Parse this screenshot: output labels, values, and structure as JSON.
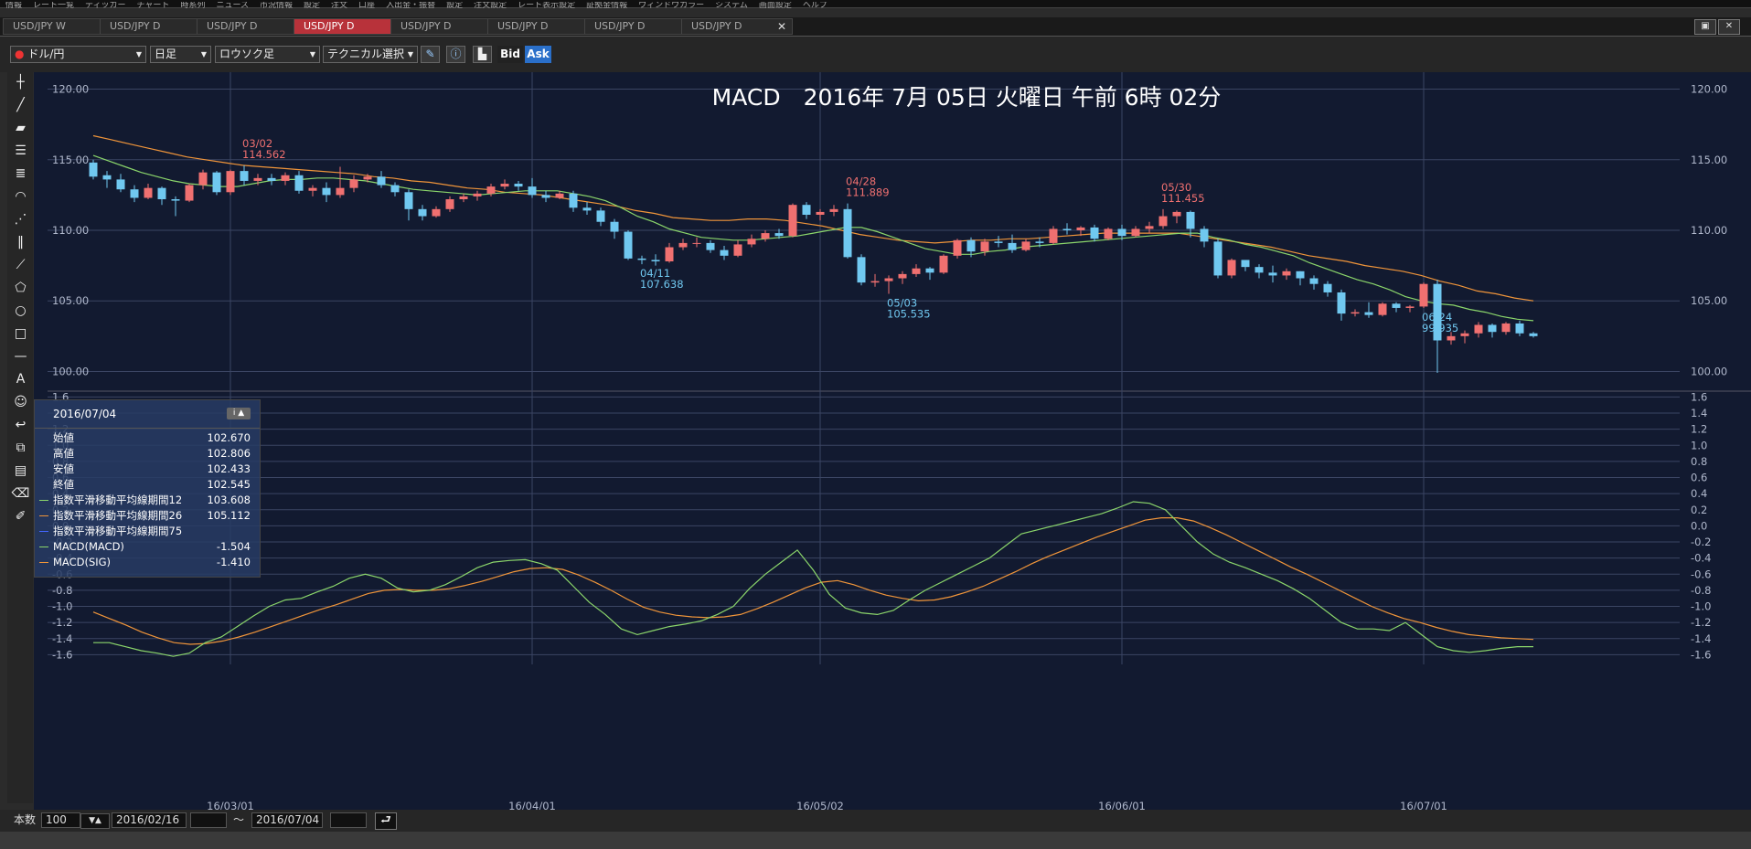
{
  "menu": [
    "情報",
    "レート一覧",
    "ティッカー",
    "チャート",
    "時系列",
    "ニュース",
    "市況情報",
    "設定",
    "注文",
    "口座",
    "入出金・振替",
    "設定",
    "注文設定",
    "レート表示設定",
    "証拠金情報",
    "ウィンドウカラー",
    "システム",
    "画面設定",
    "ヘルプ"
  ],
  "tabs": [
    {
      "label": "USD/JPY W",
      "active": false
    },
    {
      "label": "USD/JPY D",
      "active": false
    },
    {
      "label": "USD/JPY D",
      "active": false
    },
    {
      "label": "USD/JPY D",
      "active": true
    },
    {
      "label": "USD/JPY D",
      "active": false
    },
    {
      "label": "USD/JPY D",
      "active": false
    },
    {
      "label": "USD/JPY D",
      "active": false
    },
    {
      "label": "USD/JPY D",
      "active": false
    }
  ],
  "toolbar": {
    "pair": "ドル/円",
    "period": "日足",
    "chart_style": "ロウソク足",
    "technical": "テクニカル選択",
    "bid": "Bid",
    "ask": "Ask"
  },
  "colors": {
    "up": "#f07070",
    "down": "#70c8f0",
    "ema12": "#8bd66b",
    "ema26": "#f0953a",
    "macd": "#8bd66b",
    "sig": "#f0953a",
    "bg": "#121a30",
    "grid": "#3b4563"
  },
  "chart_data": {
    "type": "candlestick",
    "title": "MACD　2016年 7月 05日 火曜日 午前 6時 02分",
    "price_axis": {
      "ticks": [
        "120.00",
        "115.00",
        "110.00",
        "105.00",
        "100.00"
      ],
      "ylim": [
        98.8,
        121.2
      ]
    },
    "macd_axis": {
      "ticks": [
        "1.6",
        "1.4",
        "1.2",
        "1.0",
        "0.8",
        "0.6",
        "0.4",
        "0.2",
        "0.0",
        "-0.2",
        "-0.4",
        "-0.6",
        "-0.8",
        "-1.0",
        "-1.2",
        "-1.4",
        "-1.6"
      ],
      "ylim": [
        -1.72,
        1.65
      ]
    },
    "x_labels": [
      "16/03/01",
      "16/04/01",
      "16/05/02",
      "16/06/01",
      "16/07/01"
    ],
    "annotations": [
      {
        "date": "03/02",
        "value": "114.562",
        "color": "#f07070"
      },
      {
        "date": "04/11",
        "value": "107.638",
        "color": "#70c8f0"
      },
      {
        "date": "04/28",
        "value": "111.889",
        "color": "#f07070"
      },
      {
        "date": "05/03",
        "value": "105.535",
        "color": "#70c8f0"
      },
      {
        "date": "05/30",
        "value": "111.455",
        "color": "#f07070"
      },
      {
        "date": "06/24",
        "value": "99.935",
        "color": "#70c8f0"
      }
    ],
    "candles": [
      [
        114.8,
        113.8,
        115.0,
        113.6
      ],
      [
        113.9,
        113.6,
        114.2,
        113.0
      ],
      [
        113.6,
        112.9,
        114.0,
        112.7
      ],
      [
        112.9,
        112.3,
        113.2,
        112.0
      ],
      [
        112.3,
        113.0,
        113.3,
        112.2
      ],
      [
        113.0,
        112.2,
        113.1,
        111.8
      ],
      [
        112.2,
        112.1,
        112.4,
        111.0
      ],
      [
        112.1,
        113.2,
        113.3,
        112.0
      ],
      [
        113.2,
        114.1,
        114.3,
        112.9
      ],
      [
        114.1,
        112.7,
        114.2,
        112.5
      ],
      [
        112.7,
        114.2,
        114.3,
        112.5
      ],
      [
        114.2,
        113.5,
        114.6,
        113.2
      ],
      [
        113.5,
        113.7,
        114.0,
        113.2
      ],
      [
        113.7,
        113.5,
        114.0,
        113.2
      ],
      [
        113.5,
        113.9,
        114.1,
        113.2
      ],
      [
        113.9,
        112.8,
        114.2,
        112.6
      ],
      [
        112.8,
        113.0,
        113.2,
        112.4
      ],
      [
        113.0,
        112.5,
        113.4,
        112.0
      ],
      [
        112.5,
        113.0,
        114.5,
        112.3
      ],
      [
        113.0,
        113.6,
        113.9,
        112.7
      ],
      [
        113.6,
        113.8,
        114.0,
        113.4
      ],
      [
        113.8,
        113.2,
        114.2,
        113.0
      ],
      [
        113.2,
        112.7,
        113.4,
        112.4
      ],
      [
        112.7,
        111.5,
        112.9,
        110.7
      ],
      [
        111.5,
        111.0,
        111.8,
        110.7
      ],
      [
        111.0,
        111.5,
        111.7,
        110.9
      ],
      [
        111.5,
        112.2,
        112.4,
        111.3
      ],
      [
        112.2,
        112.4,
        112.6,
        112.0
      ],
      [
        112.4,
        112.6,
        112.8,
        112.1
      ],
      [
        112.6,
        113.1,
        113.3,
        112.4
      ],
      [
        113.1,
        113.3,
        113.6,
        112.9
      ],
      [
        113.3,
        113.1,
        113.5,
        112.8
      ],
      [
        113.1,
        112.5,
        113.7,
        112.3
      ],
      [
        112.5,
        112.3,
        112.8,
        112.0
      ],
      [
        112.3,
        112.6,
        112.8,
        112.2
      ],
      [
        112.6,
        111.6,
        112.8,
        111.3
      ],
      [
        111.6,
        111.4,
        112.0,
        111.1
      ],
      [
        111.4,
        110.6,
        111.6,
        110.3
      ],
      [
        110.6,
        109.9,
        110.8,
        109.4
      ],
      [
        109.9,
        108.0,
        110.0,
        107.9
      ],
      [
        108.0,
        107.9,
        108.2,
        107.6
      ],
      [
        107.9,
        107.8,
        108.3,
        107.5
      ],
      [
        107.8,
        108.8,
        109.1,
        107.7
      ],
      [
        108.8,
        109.1,
        109.4,
        108.6
      ],
      [
        109.1,
        109.1,
        109.5,
        108.8
      ],
      [
        109.1,
        108.6,
        109.3,
        108.4
      ],
      [
        108.6,
        108.2,
        108.9,
        107.9
      ],
      [
        108.2,
        109.0,
        109.3,
        108.1
      ],
      [
        109.0,
        109.4,
        109.7,
        108.8
      ],
      [
        109.4,
        109.8,
        110.0,
        109.2
      ],
      [
        109.8,
        109.6,
        110.1,
        109.4
      ],
      [
        109.6,
        111.8,
        111.9,
        109.5
      ],
      [
        111.8,
        111.1,
        112.0,
        110.8
      ],
      [
        111.1,
        111.3,
        111.5,
        110.7
      ],
      [
        111.3,
        111.5,
        111.8,
        111.0
      ],
      [
        111.5,
        108.1,
        111.9,
        108.0
      ],
      [
        108.1,
        106.3,
        108.3,
        106.1
      ],
      [
        106.3,
        106.4,
        106.9,
        106.0
      ],
      [
        106.4,
        106.6,
        106.8,
        105.5
      ],
      [
        106.6,
        106.9,
        107.1,
        106.2
      ],
      [
        106.9,
        107.3,
        107.6,
        106.7
      ],
      [
        107.3,
        107.0,
        107.4,
        106.5
      ],
      [
        107.0,
        108.2,
        108.3,
        106.9
      ],
      [
        108.2,
        109.3,
        109.4,
        108.0
      ],
      [
        109.3,
        108.5,
        109.5,
        108.1
      ],
      [
        108.5,
        109.2,
        109.4,
        108.2
      ],
      [
        109.2,
        109.1,
        109.6,
        108.8
      ],
      [
        109.1,
        108.6,
        109.7,
        108.4
      ],
      [
        108.6,
        109.2,
        109.4,
        108.5
      ],
      [
        109.2,
        109.1,
        109.5,
        108.8
      ],
      [
        109.1,
        110.1,
        110.3,
        109.0
      ],
      [
        110.1,
        110.0,
        110.5,
        109.7
      ],
      [
        110.0,
        110.2,
        110.3,
        109.6
      ],
      [
        110.2,
        109.4,
        110.4,
        109.2
      ],
      [
        109.4,
        110.1,
        110.2,
        109.3
      ],
      [
        110.1,
        109.6,
        110.4,
        109.3
      ],
      [
        109.6,
        110.1,
        110.3,
        109.5
      ],
      [
        110.1,
        110.3,
        110.6,
        109.8
      ],
      [
        110.3,
        111.0,
        111.5,
        110.1
      ],
      [
        111.0,
        111.3,
        111.4,
        110.5
      ],
      [
        111.3,
        110.1,
        111.4,
        109.5
      ],
      [
        110.1,
        109.2,
        110.3,
        108.8
      ],
      [
        109.2,
        106.8,
        109.4,
        106.6
      ],
      [
        106.8,
        107.9,
        108.0,
        106.6
      ],
      [
        107.9,
        107.4,
        107.9,
        107.1
      ],
      [
        107.4,
        107.0,
        107.6,
        106.6
      ],
      [
        107.0,
        106.8,
        107.5,
        106.3
      ],
      [
        106.8,
        107.1,
        107.3,
        106.5
      ],
      [
        107.1,
        106.6,
        107.1,
        106.1
      ],
      [
        106.6,
        106.2,
        106.8,
        105.8
      ],
      [
        106.2,
        105.6,
        106.4,
        105.3
      ],
      [
        105.6,
        104.1,
        105.8,
        103.6
      ],
      [
        104.1,
        104.2,
        104.4,
        103.9
      ],
      [
        104.2,
        104.0,
        104.9,
        103.8
      ],
      [
        104.0,
        104.8,
        104.9,
        103.9
      ],
      [
        104.8,
        104.5,
        104.9,
        104.2
      ],
      [
        104.5,
        104.6,
        104.7,
        104.2
      ],
      [
        104.6,
        106.2,
        106.3,
        104.5
      ],
      [
        106.2,
        102.2,
        106.5,
        99.9
      ],
      [
        102.2,
        102.5,
        102.8,
        101.9
      ],
      [
        102.5,
        102.7,
        102.9,
        102.0
      ],
      [
        102.7,
        103.3,
        103.5,
        102.4
      ],
      [
        103.3,
        102.8,
        103.4,
        102.4
      ],
      [
        102.8,
        103.4,
        103.5,
        102.6
      ],
      [
        103.4,
        102.7,
        103.6,
        102.5
      ],
      [
        102.7,
        102.5,
        102.8,
        102.4
      ]
    ],
    "first_x": 102,
    "last_x": 1677,
    "xlabel_idx": [
      10,
      32,
      53,
      75,
      97
    ],
    "ema12": [
      115.3,
      114.9,
      114.5,
      114.1,
      113.8,
      113.5,
      113.3,
      113.2,
      113.1,
      113.1,
      113.3,
      113.5,
      113.6,
      113.6,
      113.7,
      113.7,
      113.6,
      113.5,
      113.3,
      113.1,
      112.9,
      112.8,
      112.7,
      112.6,
      112.5,
      112.6,
      112.7,
      112.8,
      112.8,
      112.8,
      112.6,
      112.4,
      112.1,
      111.6,
      111.0,
      110.6,
      110.1,
      109.8,
      109.5,
      109.4,
      109.3,
      109.3,
      109.4,
      109.5,
      109.6,
      109.8,
      110.0,
      110.2,
      110.2,
      109.9,
      109.5,
      109.1,
      108.7,
      108.5,
      108.3,
      108.3,
      108.5,
      108.6,
      108.8,
      108.9,
      109.0,
      109.1,
      109.2,
      109.3,
      109.4,
      109.5,
      109.6,
      109.7,
      109.8,
      109.8,
      109.5,
      109.3,
      109.0,
      108.8,
      108.5,
      108.2,
      107.7,
      107.3,
      106.9,
      106.5,
      106.2,
      105.8,
      105.3,
      105.0,
      104.8,
      104.7,
      104.4,
      104.2,
      103.9,
      103.7,
      103.6
    ],
    "ema26": [
      116.7,
      116.4,
      116.1,
      115.8,
      115.5,
      115.2,
      115.0,
      114.8,
      114.6,
      114.5,
      114.4,
      114.3,
      114.2,
      114.1,
      114.0,
      113.8,
      113.7,
      113.5,
      113.4,
      113.2,
      113.0,
      112.9,
      112.7,
      112.6,
      112.5,
      112.3,
      112.1,
      111.9,
      111.7,
      111.4,
      111.2,
      110.9,
      110.8,
      110.7,
      110.7,
      110.8,
      110.8,
      110.7,
      110.5,
      110.3,
      110.0,
      109.7,
      109.5,
      109.3,
      109.2,
      109.1,
      109.2,
      109.3,
      109.3,
      109.4,
      109.4,
      109.5,
      109.6,
      109.7,
      109.8,
      109.8,
      109.8,
      109.8,
      109.8,
      109.6,
      109.4,
      109.2,
      109.0,
      108.8,
      108.5,
      108.2,
      108.0,
      107.8,
      107.5,
      107.3,
      107.1,
      106.8,
      106.4,
      106.1,
      105.7,
      105.5,
      105.2,
      105.0
    ],
    "ema12_start": 0,
    "ema26_start": 0,
    "macd": [
      -1.45,
      -1.45,
      -1.5,
      -1.55,
      -1.58,
      -1.62,
      -1.58,
      -1.45,
      -1.38,
      -1.25,
      -1.12,
      -1.0,
      -0.92,
      -0.9,
      -0.82,
      -0.75,
      -0.65,
      -0.6,
      -0.65,
      -0.77,
      -0.82,
      -0.8,
      -0.73,
      -0.63,
      -0.52,
      -0.45,
      -0.43,
      -0.42,
      -0.47,
      -0.55,
      -0.75,
      -0.95,
      -1.1,
      -1.28,
      -1.35,
      -1.3,
      -1.25,
      -1.22,
      -1.18,
      -1.1,
      -1.0,
      -0.78,
      -0.6,
      -0.45,
      -0.3,
      -0.55,
      -0.85,
      -1.02,
      -1.08,
      -1.1,
      -1.05,
      -0.92,
      -0.8,
      -0.7,
      -0.6,
      -0.5,
      -0.4,
      -0.25,
      -0.1,
      -0.05,
      0.0,
      0.05,
      0.1,
      0.15,
      0.22,
      0.3,
      0.28,
      0.2,
      0.0,
      -0.2,
      -0.35,
      -0.45,
      -0.52,
      -0.6,
      -0.68,
      -0.78,
      -0.9,
      -1.05,
      -1.2,
      -1.28,
      -1.28,
      -1.3,
      -1.2,
      -1.35,
      -1.5,
      -1.55,
      -1.57,
      -1.55,
      -1.52,
      -1.5,
      -1.5
    ],
    "sig": [
      -1.07,
      -1.15,
      -1.23,
      -1.32,
      -1.39,
      -1.45,
      -1.47,
      -1.46,
      -1.43,
      -1.38,
      -1.32,
      -1.25,
      -1.18,
      -1.11,
      -1.04,
      -0.98,
      -0.91,
      -0.84,
      -0.8,
      -0.79,
      -0.8,
      -0.8,
      -0.78,
      -0.74,
      -0.69,
      -0.63,
      -0.57,
      -0.53,
      -0.52,
      -0.54,
      -0.61,
      -0.7,
      -0.8,
      -0.91,
      -1.01,
      -1.07,
      -1.11,
      -1.13,
      -1.14,
      -1.13,
      -1.1,
      -1.03,
      -0.95,
      -0.86,
      -0.77,
      -0.7,
      -0.68,
      -0.73,
      -0.8,
      -0.86,
      -0.9,
      -0.93,
      -0.92,
      -0.88,
      -0.82,
      -0.75,
      -0.66,
      -0.57,
      -0.47,
      -0.38,
      -0.3,
      -0.22,
      -0.14,
      -0.07,
      0.0,
      0.07,
      0.1,
      0.1,
      0.06,
      -0.02,
      -0.11,
      -0.21,
      -0.31,
      -0.41,
      -0.51,
      -0.6,
      -0.7,
      -0.8,
      -0.9,
      -1.0,
      -1.08,
      -1.15,
      -1.2,
      -1.26,
      -1.31,
      -1.35,
      -1.37,
      -1.39,
      -1.4,
      -1.41
    ]
  },
  "info_panel": {
    "date": "2016/07/04",
    "rows": [
      {
        "label": "始値",
        "value": "102.670",
        "color": ""
      },
      {
        "label": "高値",
        "value": "102.806",
        "color": ""
      },
      {
        "label": "安値",
        "value": "102.433",
        "color": ""
      },
      {
        "label": "終値",
        "value": "102.545",
        "color": ""
      },
      {
        "label": "指数平滑移動平均線期間12",
        "value": "103.608",
        "color": "#8bd66b"
      },
      {
        "label": "指数平滑移動平均線期間26",
        "value": "105.112",
        "color": "#f0953a"
      },
      {
        "label": "指数平滑移動平均線期間75",
        "value": "",
        "color": "#4466ff"
      },
      {
        "label": "MACD(MACD)",
        "value": "-1.504",
        "color": "#8bd66b"
      },
      {
        "label": "MACD(SIG)",
        "value": "-1.410",
        "color": "#f0953a"
      }
    ]
  },
  "bottom": {
    "count_label": "本数",
    "count_value": "100",
    "date_from": "2016/02/16",
    "tilde": "〜",
    "date_to": "2016/07/04"
  }
}
